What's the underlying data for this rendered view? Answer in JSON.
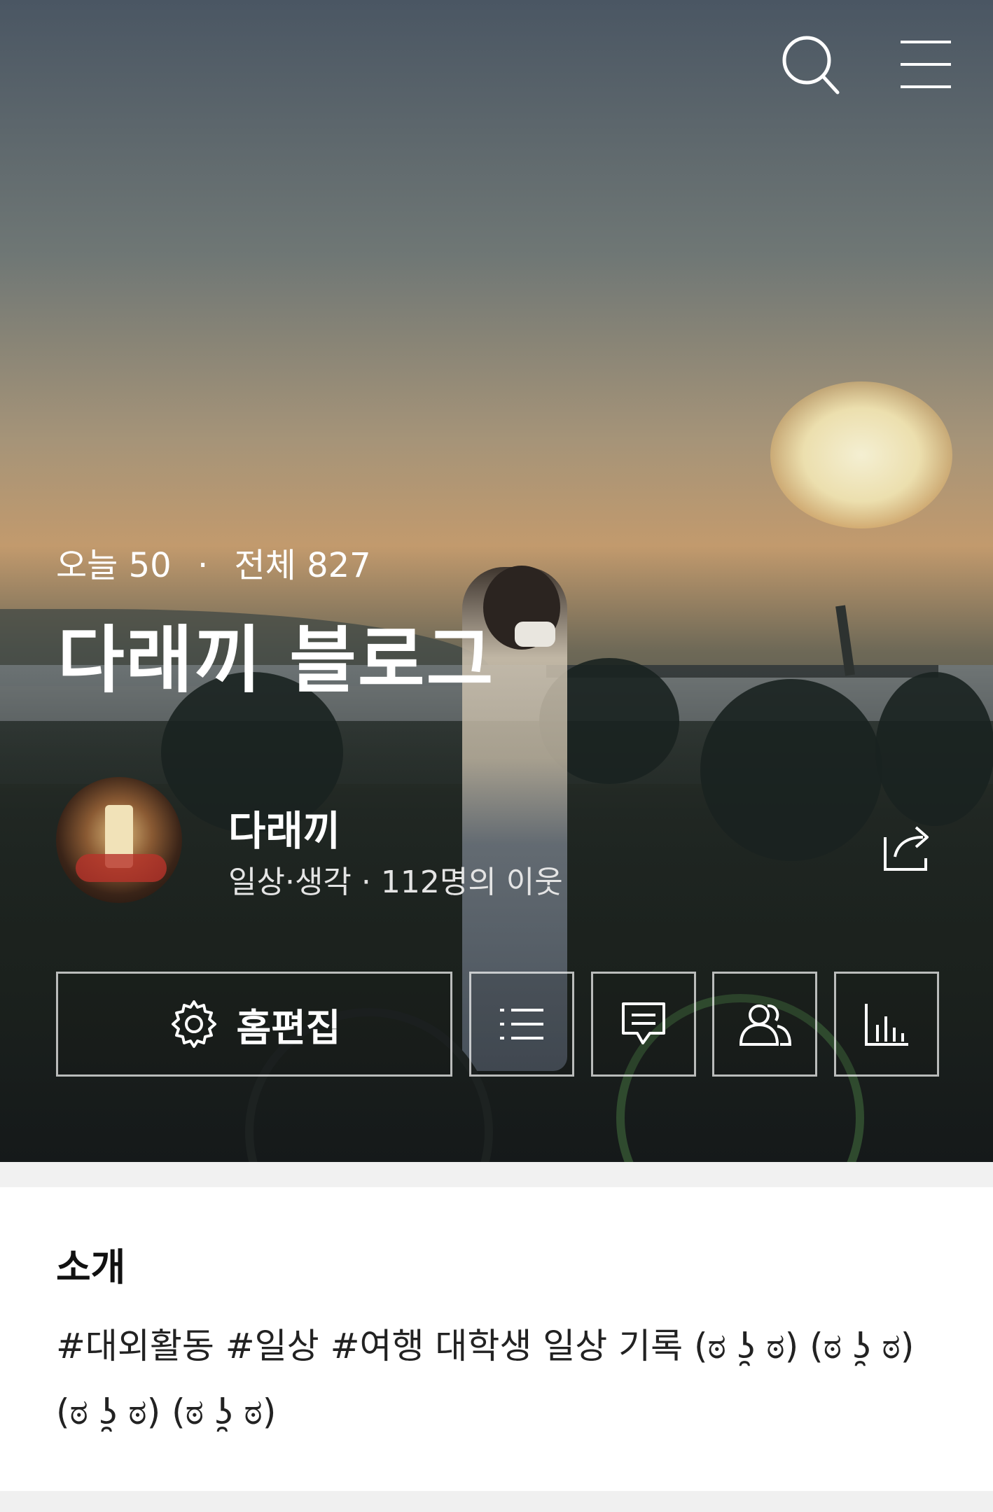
{
  "header": {
    "search_icon": "search-icon",
    "menu_icon": "hamburger-menu-icon"
  },
  "stats": {
    "today_label": "오늘",
    "today_count": "50",
    "separator": "·",
    "total_label": "전체",
    "total_count": "827"
  },
  "blog": {
    "title": "다래끼 블로그"
  },
  "profile": {
    "nickname": "다래끼",
    "info": "일상·생각 · 112명의 이웃"
  },
  "actions": {
    "edit_home_label": "홈편집",
    "icons": [
      "settings-gear-icon",
      "list-icon",
      "comment-icon",
      "neighbors-icon",
      "stats-chart-icon",
      "share-icon"
    ]
  },
  "intro": {
    "title": "소개",
    "text": "#대외활동 #일상 #여행 대학생 일상 기록 (ಠ ʖ̯ ಠ) (ಠ ʖ̯ ಠ) (ಠ ʖ̯ ಠ) (ಠ ʖ̯ ಠ)"
  },
  "colors": {
    "hero_text": "#ffffff",
    "card_bg": "#ffffff",
    "page_bg": "#f2f2f2"
  }
}
